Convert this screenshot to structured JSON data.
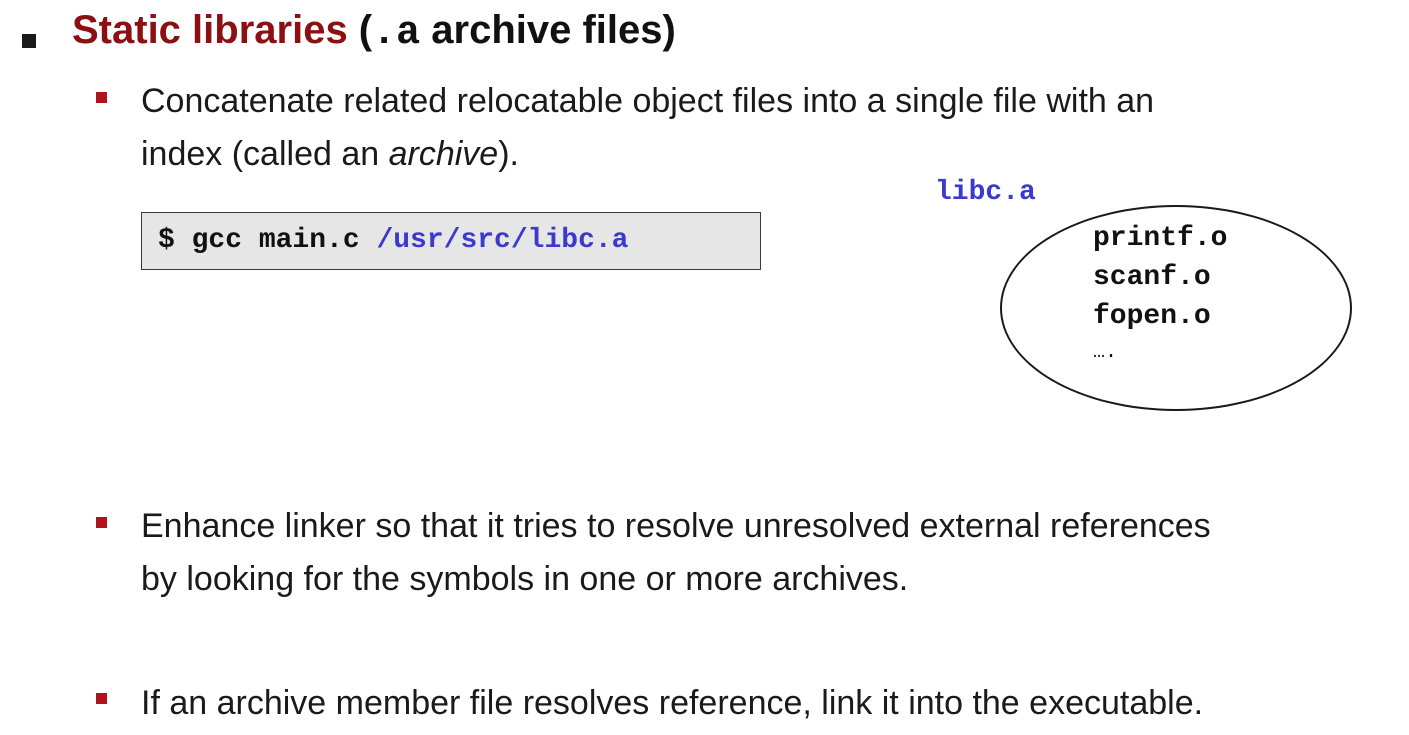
{
  "heading": {
    "accent_text": "Static libraries",
    "mid_text": " (",
    "code_text": ".a",
    "end_text": " archive files)"
  },
  "bullets": [
    {
      "line1": "Concatenate related relocatable object files into a single file with an",
      "line2_prefix": "index (called an ",
      "line2_italic": "archive",
      "line2_suffix": ")."
    },
    {
      "line1": "Enhance linker so that it tries to resolve unresolved external references",
      "line2": "by looking for the symbols in one or more archives."
    },
    {
      "line1": "If an archive member file resolves reference, link it  into the executable."
    }
  ],
  "command": {
    "prefix": "$ gcc main.c ",
    "path": "/usr/src/libc.a"
  },
  "archive": {
    "label": "libc.a",
    "members": [
      "printf.o",
      "scanf.o",
      "fopen.o"
    ],
    "more": "…."
  },
  "colors": {
    "accent": "#8c0f12",
    "bullet": "#b0141a",
    "code_blue": "#3a3acc",
    "command_box_bg": "#e6e6e6"
  },
  "icons": {
    "level1_bullet": "square-bullet-icon",
    "level2_bullet": "square-bullet-icon"
  }
}
